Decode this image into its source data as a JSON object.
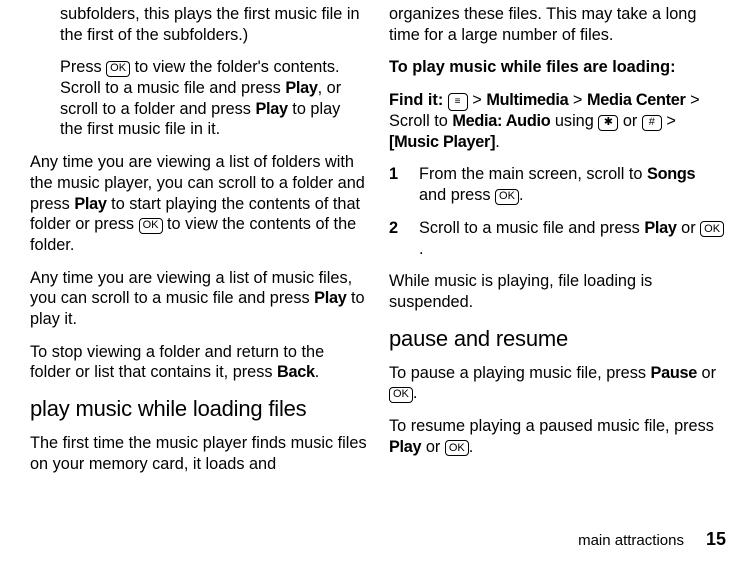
{
  "keys": {
    "ok": "OK",
    "menu": "≡",
    "star": "✱",
    "hash": "#"
  },
  "left": {
    "p1a": "subfolders, this plays the first music file in the first of the subfolders.)",
    "p2a": "Press ",
    "p2b": " to view the folder's contents. Scroll to a music file and press ",
    "p2b_bold": "Play",
    "p2c": ", or scroll to a folder and press ",
    "p2c_bold": "Play",
    "p2d": " to play the first music file in it.",
    "p3a": "Any time you are viewing a list of folders with the music player, you can scroll to a folder and press ",
    "p3a_bold": "Play",
    "p3b": " to start playing the contents of that folder or press ",
    "p3c": " to view the contents of the folder.",
    "p4a": "Any time you are viewing a list of music files, you can scroll to a music file and press ",
    "p4a_bold": "Play",
    "p4b": " to play it.",
    "p5a": "To stop viewing a folder and return to the folder or list that contains it, press ",
    "p5a_bold": "Back",
    "p5b": ".",
    "h2": "play music while loading files",
    "p6": "The first time the music player finds music files on your memory card, it loads and"
  },
  "right": {
    "p1": "organizes these files. This may take a long time for a large number of files.",
    "p2_bold": "To play music while files are loading:",
    "p3a_bold": "Find it: ",
    "p3b": " > ",
    "p3b_bold": "Multimedia",
    "p3c": " > ",
    "p3c_bold": "Media Center",
    "p3d": " > Scroll to ",
    "p3d_bold": "Media: Audio",
    "p3e": " using ",
    "p3f": "  or  ",
    "p3g": "  > ",
    "p3g_bold": "[Music Player]",
    "p3h": ".",
    "li1a": "From the main screen, scroll to ",
    "li1a_bold": "Songs",
    "li1b": " and press ",
    "li1c": ".",
    "li2a": "Scroll to a music file and press ",
    "li2a_bold": "Play",
    "li2b": " or ",
    "li2c": ".",
    "p4": "While music is playing, file loading is suspended.",
    "h2": "pause and resume",
    "p5a": "To pause a playing music file, press ",
    "p5a_bold": "Pause",
    "p5b": " or ",
    "p5c": ".",
    "p6a": "To resume playing a paused music file, press ",
    "p6a_bold": "Play",
    "p6b": " or ",
    "p6c": "."
  },
  "footer": {
    "section": "main attractions",
    "page": "15"
  }
}
